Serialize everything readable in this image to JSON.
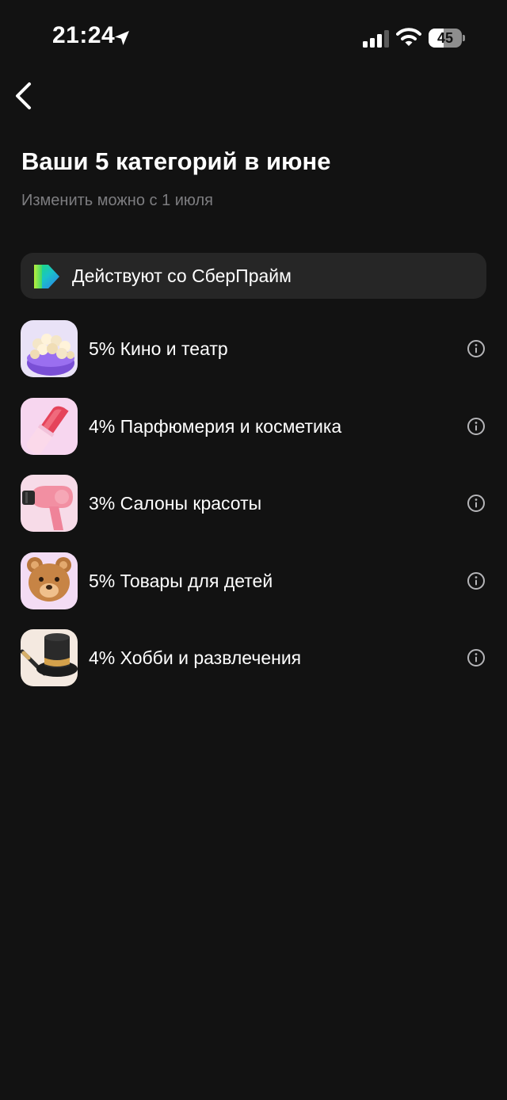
{
  "status_bar": {
    "time": "21:24",
    "battery": "45",
    "battery_level": 0.45,
    "icons": [
      "location-arrow-icon",
      "cellular-signal-icon",
      "wifi-icon",
      "battery-icon"
    ]
  },
  "nav": {
    "back_icon": "chevron-left-icon"
  },
  "header": {
    "title": "Ваши 5 категорий в июне",
    "subtitle": "Изменить можно с 1 июля"
  },
  "prime_banner": {
    "text": "Действуют со СберПрайм",
    "logo_icon": "sberprime-logo"
  },
  "colors": {
    "background": "#121212",
    "banner_background": "#262626",
    "subtitle": "#7d7d80",
    "icon_gray": "#b5b5b8"
  },
  "categories": [
    {
      "label": "5% Кино и театр",
      "icon": "popcorn-icon",
      "info_icon": "info-circle-icon"
    },
    {
      "label": "4% Парфюмерия и косметика",
      "icon": "lipstick-icon",
      "info_icon": "info-circle-icon"
    },
    {
      "label": "3% Салоны красоты",
      "icon": "hair-dryer-icon",
      "info_icon": "info-circle-icon"
    },
    {
      "label": "5% Товары для детей",
      "icon": "teddy-bear-icon",
      "info_icon": "info-circle-icon"
    },
    {
      "label": "4% Хобби и развлечения",
      "icon": "top-hat-icon",
      "info_icon": "info-circle-icon"
    }
  ]
}
